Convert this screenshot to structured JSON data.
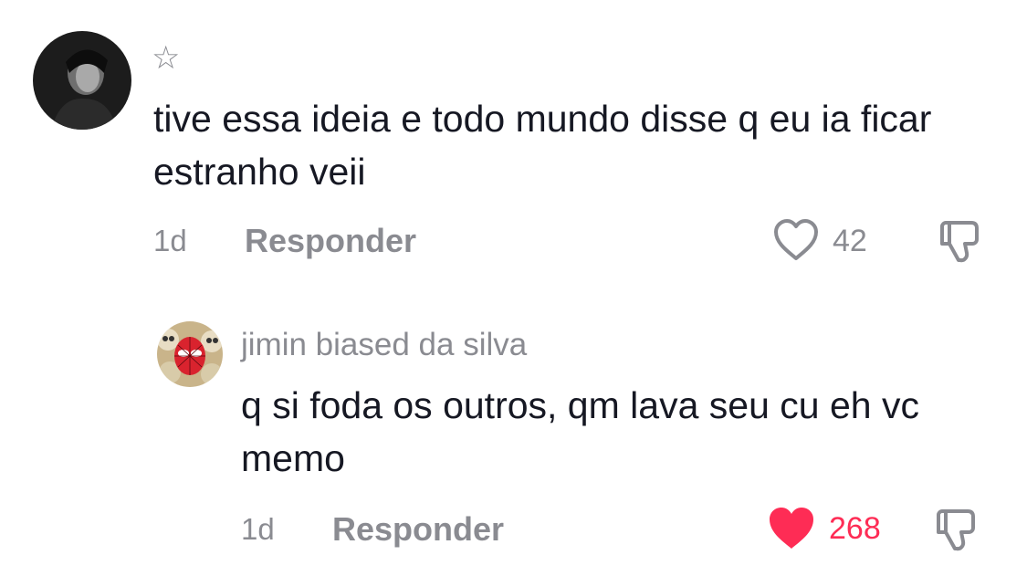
{
  "comments": [
    {
      "username": "☆",
      "text": "tive essa ideia e todo mundo disse q eu ia ficar estranho veii",
      "time": "1d",
      "reply_label": "Responder",
      "likes": "42",
      "liked": false
    },
    {
      "username": "jimin biased da silva",
      "text": "q si foda os outros, qm lava seu cu eh vc memo",
      "time": "1d",
      "reply_label": "Responder",
      "likes": "268",
      "liked": true
    }
  ],
  "colors": {
    "like_active": "#fe2c55",
    "secondary_text": "#8a8b91",
    "primary_text": "#161823"
  }
}
